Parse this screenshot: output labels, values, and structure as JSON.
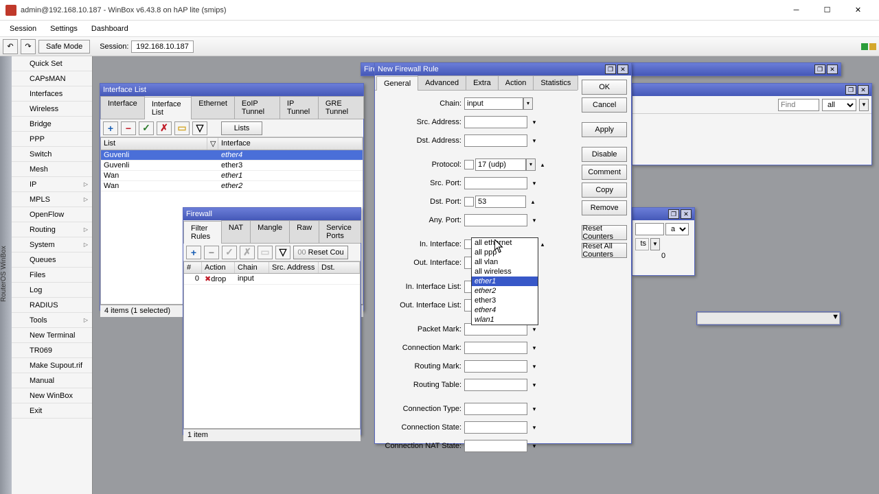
{
  "window": {
    "title": "admin@192.168.10.187 - WinBox v6.43.8 on hAP lite (smips)"
  },
  "menubar": {
    "items": [
      "Session",
      "Settings",
      "Dashboard"
    ]
  },
  "toolbar": {
    "safe_mode": "Safe Mode",
    "session_label": "Session:",
    "session_value": "192.168.10.187"
  },
  "side_strip": "RouterOS WinBox",
  "menu": {
    "items": [
      {
        "label": "Quick Set",
        "arrow": false
      },
      {
        "label": "CAPsMAN",
        "arrow": false
      },
      {
        "label": "Interfaces",
        "arrow": false
      },
      {
        "label": "Wireless",
        "arrow": false
      },
      {
        "label": "Bridge",
        "arrow": false
      },
      {
        "label": "PPP",
        "arrow": false
      },
      {
        "label": "Switch",
        "arrow": false
      },
      {
        "label": "Mesh",
        "arrow": false
      },
      {
        "label": "IP",
        "arrow": true
      },
      {
        "label": "MPLS",
        "arrow": true
      },
      {
        "label": "OpenFlow",
        "arrow": false
      },
      {
        "label": "Routing",
        "arrow": true
      },
      {
        "label": "System",
        "arrow": true
      },
      {
        "label": "Queues",
        "arrow": false
      },
      {
        "label": "Files",
        "arrow": false
      },
      {
        "label": "Log",
        "arrow": false
      },
      {
        "label": "RADIUS",
        "arrow": false
      },
      {
        "label": "Tools",
        "arrow": true
      },
      {
        "label": "New Terminal",
        "arrow": false
      },
      {
        "label": "TR069",
        "arrow": false
      },
      {
        "label": "Make Supout.rif",
        "arrow": false
      },
      {
        "label": "Manual",
        "arrow": false
      },
      {
        "label": "New WinBox",
        "arrow": false
      },
      {
        "label": "Exit",
        "arrow": false
      }
    ]
  },
  "interface_list": {
    "title": "Interface List",
    "tabs": [
      "Interface",
      "Interface List",
      "Ethernet",
      "EoIP Tunnel",
      "IP Tunnel",
      "GRE Tunnel"
    ],
    "active_tab": 1,
    "lists_btn": "Lists",
    "columns": [
      "List",
      "Interface"
    ],
    "rows": [
      {
        "list": "Guvenli",
        "iface": "ether4",
        "selected": true,
        "italic": true
      },
      {
        "list": "Guvenli",
        "iface": "ether3",
        "selected": false,
        "italic": false
      },
      {
        "list": "Wan",
        "iface": "ether1",
        "selected": false,
        "italic": true
      },
      {
        "list": "Wan",
        "iface": "ether2",
        "selected": false,
        "italic": true
      }
    ],
    "status": "4 items (1 selected)"
  },
  "firewall": {
    "title": "Firewall",
    "tabs": [
      "Filter Rules",
      "NAT",
      "Mangle",
      "Raw",
      "Service Ports"
    ],
    "active_tab": 0,
    "reset_btn": "Reset Cou",
    "columns": [
      "#",
      "Action",
      "Chain",
      "Src. Address",
      "Dst."
    ],
    "rows": [
      {
        "num": "0",
        "action": "drop",
        "chain": "input"
      }
    ],
    "status": "1 item"
  },
  "new_rule": {
    "title": "New Firewall Rule",
    "tabs": [
      "General",
      "Advanced",
      "Extra",
      "Action",
      "Statistics"
    ],
    "active_tab": 0,
    "fields": {
      "chain": {
        "label": "Chain:",
        "value": "input"
      },
      "src_addr": {
        "label": "Src. Address:",
        "value": ""
      },
      "dst_addr": {
        "label": "Dst. Address:",
        "value": ""
      },
      "protocol": {
        "label": "Protocol:",
        "value": "17 (udp)"
      },
      "src_port": {
        "label": "Src. Port:",
        "value": ""
      },
      "dst_port": {
        "label": "Dst. Port:",
        "value": "53"
      },
      "any_port": {
        "label": "Any. Port:",
        "value": ""
      },
      "in_iface": {
        "label": "In. Interface:",
        "value": "ether1"
      },
      "out_iface": {
        "label": "Out. Interface:",
        "value": ""
      },
      "in_iface_list": {
        "label": "In. Interface List:",
        "value": ""
      },
      "out_iface_list": {
        "label": "Out. Interface List:",
        "value": ""
      },
      "packet_mark": {
        "label": "Packet Mark:",
        "value": ""
      },
      "conn_mark": {
        "label": "Connection Mark:",
        "value": ""
      },
      "routing_mark": {
        "label": "Routing Mark:",
        "value": ""
      },
      "routing_table": {
        "label": "Routing Table:",
        "value": ""
      },
      "conn_type": {
        "label": "Connection Type:",
        "value": ""
      },
      "conn_state": {
        "label": "Connection State:",
        "value": ""
      },
      "conn_nat_state": {
        "label": "Connection NAT State:",
        "value": ""
      }
    },
    "buttons": [
      "OK",
      "Cancel",
      "Apply",
      "Disable",
      "Comment",
      "Copy",
      "Remove",
      "Reset Counters",
      "Reset All Counters"
    ],
    "dropdown": {
      "items": [
        {
          "text": "all ethernet",
          "ital": false
        },
        {
          "text": "all ppp",
          "ital": false
        },
        {
          "text": "all vlan",
          "ital": false
        },
        {
          "text": "all wireless",
          "ital": false
        },
        {
          "text": "ether1",
          "ital": true,
          "hl": true
        },
        {
          "text": "ether2",
          "ital": true
        },
        {
          "text": "ether3",
          "ital": false
        },
        {
          "text": "ether4",
          "ital": true
        },
        {
          "text": "wlan1",
          "ital": true
        }
      ]
    }
  },
  "bg_windows": {
    "find": "Find",
    "all": "all",
    "zero": "0"
  }
}
